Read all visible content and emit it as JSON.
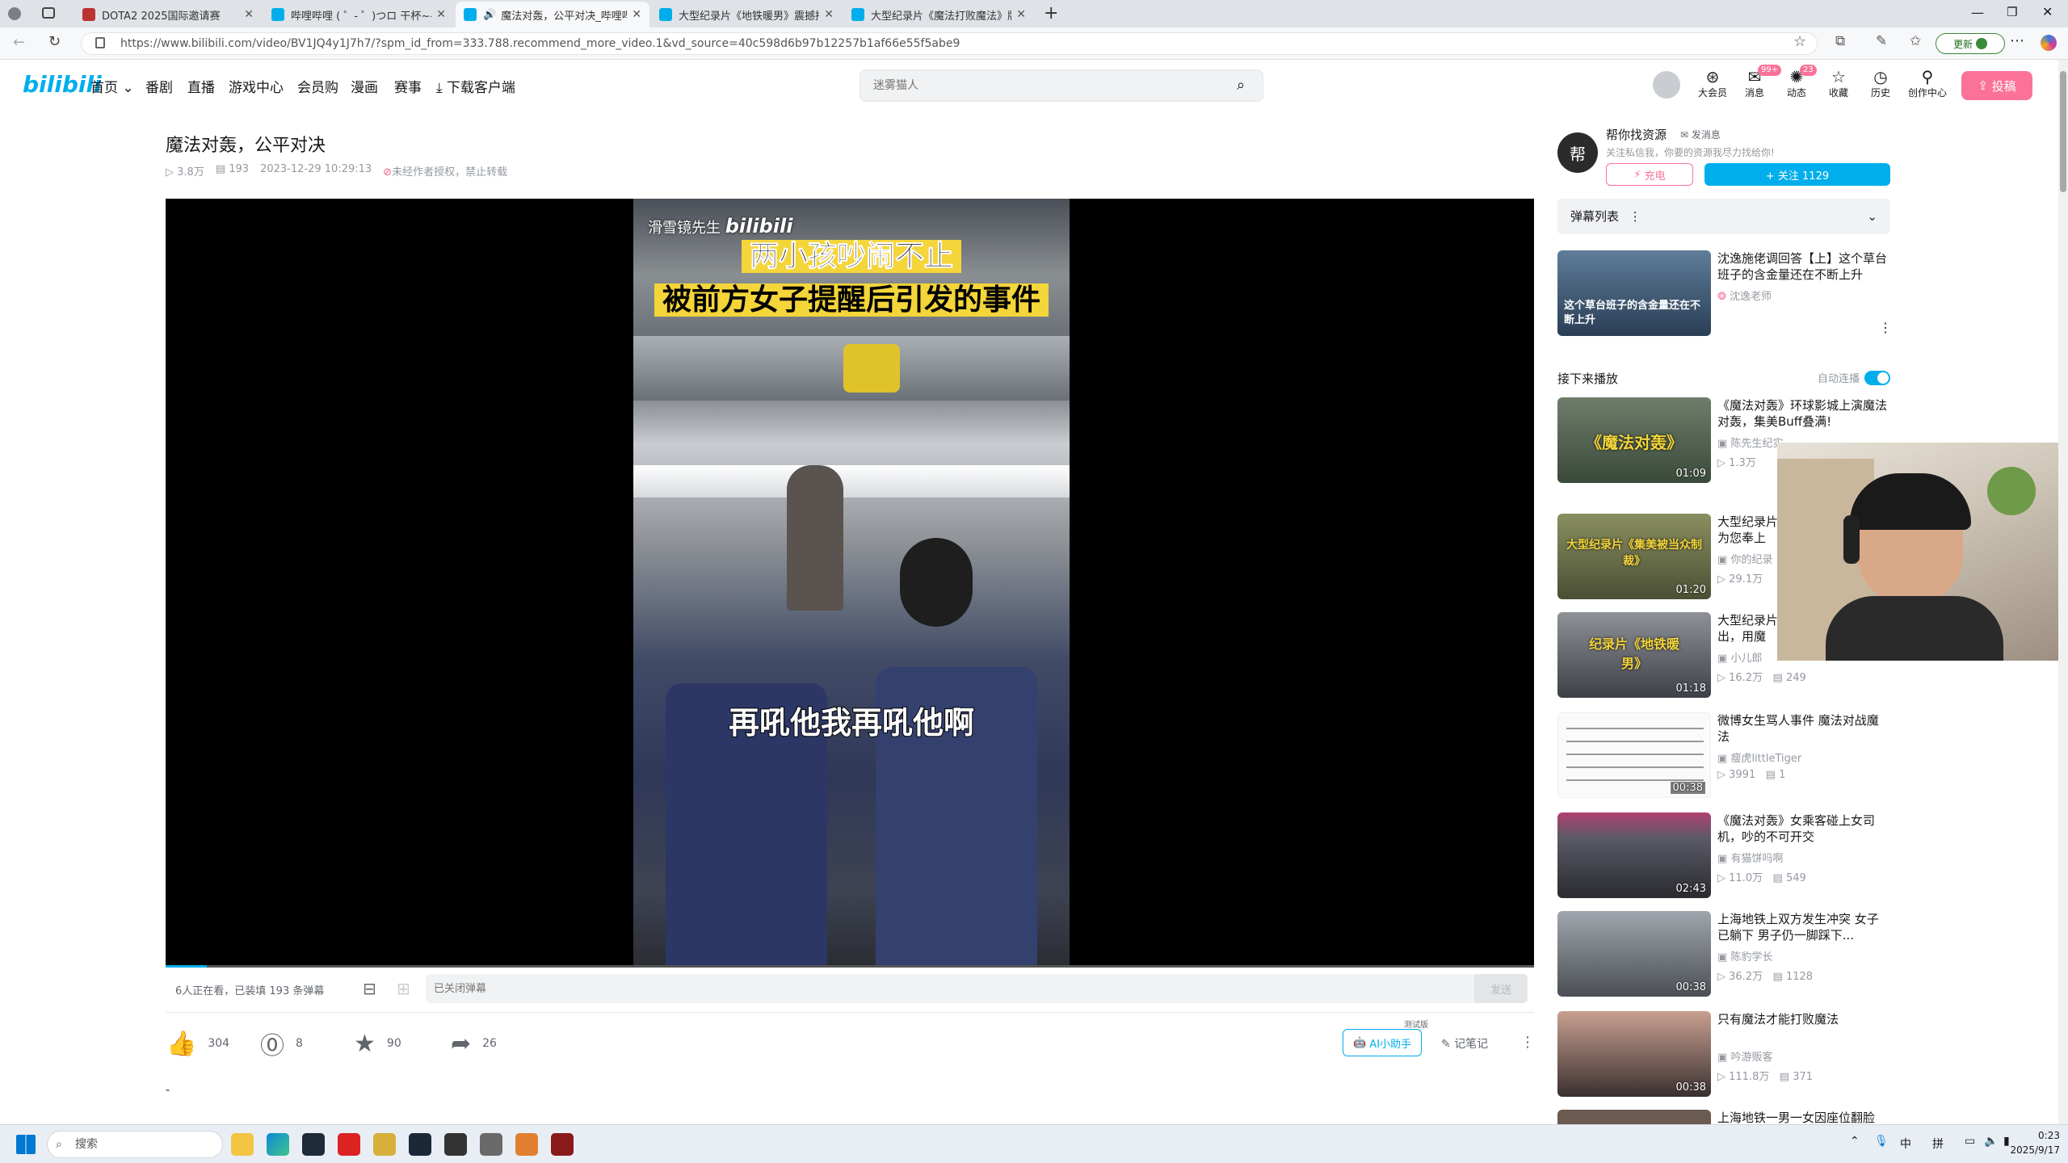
{
  "browser": {
    "tabs": [
      {
        "label": "DOTA2 2025国际邀请赛",
        "active": false
      },
      {
        "label": "哔哩哔哩 ( ゜- ゜)つロ 干杯~-bilibi",
        "active": false
      },
      {
        "label": "魔法对轰，公平对决_哔哩哔",
        "active": true
      },
      {
        "label": "大型纪录片《地铁暖男》震撼播出",
        "active": false
      },
      {
        "label": "大型纪录片《魔法打败魔法》版本",
        "active": false
      }
    ],
    "url": "https://www.bilibili.com/video/BV1JQ4y1J7h7/?spm_id_from=333.788.recommend_more_video.1&vd_source=40c598d6b97b12257b1af66e55f5abe9",
    "update_label": "更新"
  },
  "header": {
    "logo": "bilibili",
    "nav": [
      "首页",
      "番剧",
      "直播",
      "游戏中心",
      "会员购",
      "漫画",
      "赛事",
      "下载客户端"
    ],
    "search_placeholder": "迷雾猫人",
    "icons": [
      {
        "label": "大会员",
        "icon": "vip-icon",
        "badge": ""
      },
      {
        "label": "消息",
        "icon": "message-icon",
        "badge": "99+"
      },
      {
        "label": "动态",
        "icon": "dynamic-icon",
        "badge": "23"
      },
      {
        "label": "收藏",
        "icon": "favorite-icon",
        "badge": ""
      },
      {
        "label": "历史",
        "icon": "history-icon",
        "badge": ""
      },
      {
        "label": "创作中心",
        "icon": "creator-icon",
        "badge": ""
      }
    ],
    "upload_label": "投稿"
  },
  "video": {
    "title": "魔法对轰，公平对决",
    "views": "3.8万",
    "danmaku_count": "193",
    "date": "2023-12-29 10:29:13",
    "copyright": "未经作者授权，禁止转载",
    "watermark": "滑雪镜先生",
    "caption_line1": "两小孩吵闹不止",
    "caption_line2": "被前方女子提醒后引发的事件",
    "subtitle": "再吼他我再吼他啊"
  },
  "danmaku_bar": {
    "status": "6人正在看，已装填 193 条弹幕",
    "placeholder": "已关闭弹幕",
    "send": "发送"
  },
  "actions": {
    "like": "304",
    "coin": "8",
    "favorite": "90",
    "share": "26",
    "ai_assistant": "AI小助手",
    "ai_tag": "测试版",
    "notes": "记笔记"
  },
  "below_text": "-",
  "uploader": {
    "name": "帮你找资源",
    "message": "发消息",
    "desc": "关注私信我，你要的资源我尽力找给你!",
    "charge": "充电",
    "follow": "+ 关注 1129"
  },
  "danmaku_list_label": "弹幕列表",
  "ad": {
    "title": "沈逸施佬调回答【上】这个草台班子的含金量还在不断上升",
    "owner": "沈逸老师",
    "thumb_text": "这个草台班子的含金量还在不断上升"
  },
  "up_next": {
    "label": "接下来播放",
    "autoplay": "自动连播"
  },
  "recommendations": [
    {
      "title": "《魔法对轰》环球影城上演魔法对轰，集美Buff叠满!",
      "owner": "陈先生纪实",
      "views": "1.3万",
      "comments": "",
      "duration": "01:09",
      "thumb_text": "《魔法对轰》"
    },
    {
      "title": "大型纪录片《集美被当众制裁》为您奉上",
      "owner": "你的纪录",
      "views": "29.1万",
      "comments": "",
      "duration": "01:20",
      "thumb_text": "大型纪录片《集美被当众制裁》"
    },
    {
      "title": "大型纪录片《地铁暖男》震撼播出，用魔",
      "owner": "小儿郎",
      "views": "16.2万",
      "comments": "249",
      "duration": "01:18",
      "thumb_text": "纪录片《地铁暖男》"
    },
    {
      "title": "微博女生骂人事件 魔法对战魔法",
      "owner": "瘦虎littleTiger",
      "views": "3991",
      "comments": "1",
      "duration": "00:38",
      "thumb_text": ""
    },
    {
      "title": "《魔法对轰》女乘客碰上女司机，吵的不可开交",
      "owner": "有猫饼吗啊",
      "views": "11.0万",
      "comments": "549",
      "duration": "02:43",
      "thumb_text": ""
    },
    {
      "title": "上海地铁上双方发生冲突 女子已躺下 男子仍一脚踩下...",
      "owner": "陈豹学长",
      "views": "36.2万",
      "comments": "1128",
      "duration": "00:38",
      "thumb_text": ""
    },
    {
      "title": "只有魔法才能打败魔法",
      "owner": "吟游贩客",
      "views": "111.8万",
      "comments": "371",
      "duration": "00:38",
      "thumb_text": ""
    },
    {
      "title": "上海地铁一男一女因座位翻脸",
      "owner": "",
      "views": "",
      "comments": "",
      "duration": "",
      "thumb_text": ""
    }
  ],
  "taskbar": {
    "search_placeholder": "搜索",
    "lang1": "中",
    "lang2": "拼",
    "time": "0:23",
    "date": "2025/9/17"
  },
  "colors": {
    "accent": "#00aeec",
    "pink": "#fb7299",
    "text": "#18191c",
    "muted": "#9499a0",
    "caption_bg": "#f4d53a"
  }
}
